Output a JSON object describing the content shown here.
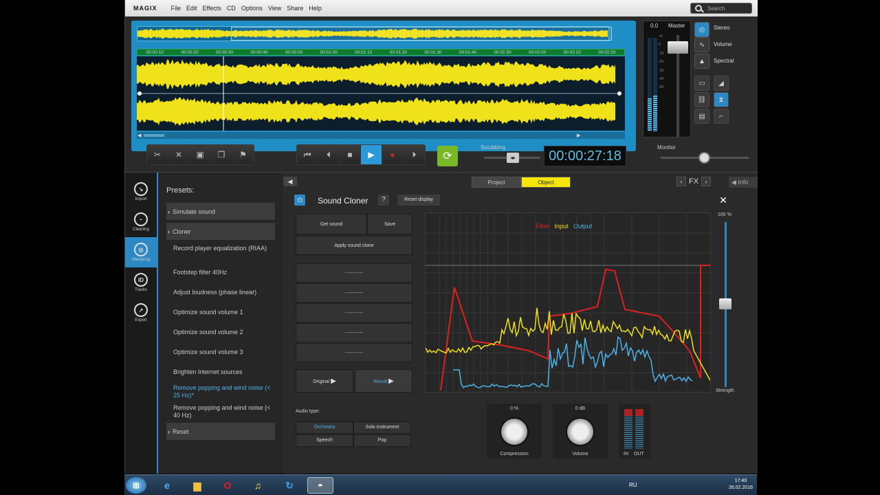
{
  "menubar": {
    "logo": "MAGIX",
    "items": [
      "File",
      "Edit",
      "Effects",
      "CD",
      "Options",
      "View",
      "Share",
      "Help"
    ],
    "search_placeholder": "Search"
  },
  "timeline": {
    "ruler_ticks": [
      "00:00:10",
      "00:00:20",
      "00:00:30",
      "00:00:40",
      "00:00:50",
      "00:01:00",
      "00:01:10",
      "00:01:20",
      "00:01:30",
      "00:01:40",
      "00:01:50",
      "00:02:00",
      "00:02:10",
      "00:02:20"
    ]
  },
  "master": {
    "value": "0.0",
    "label": "Master",
    "db_scale": [
      "+6",
      "0",
      "-10",
      "-20",
      "-30",
      "-40",
      "-50"
    ]
  },
  "view_modes": [
    "Stereo",
    "Volume",
    "Spectral"
  ],
  "transport": {
    "scrubbing_label": "Scrubbing",
    "timecode": "00:00:27:18",
    "monitor_label": "Monitor"
  },
  "sidebar": [
    "Import",
    "Cleaning",
    "Mastering",
    "Tracks",
    "Export"
  ],
  "presets": {
    "title": "Presets:",
    "items": [
      {
        "label": "Simulate sound",
        "type": "header"
      },
      {
        "label": "Cloner",
        "type": "header"
      },
      {
        "label": "Record player equalization (RIAA)",
        "type": "item"
      },
      {
        "label": "Footstep filter 40Hz",
        "type": "item"
      },
      {
        "label": "Adjust loudness (phase linear)",
        "type": "item"
      },
      {
        "label": "Optimize sound volume 1",
        "type": "item"
      },
      {
        "label": "Optimize sound volume 2",
        "type": "item"
      },
      {
        "label": "Optimize sound volume 3",
        "type": "item"
      },
      {
        "label": "Brighten Internet sources",
        "type": "item"
      },
      {
        "label": "Remove popping and wind noise (< 25 Hz)*",
        "type": "selected"
      },
      {
        "label": "Remove popping and wind noise (< 40 Hz)",
        "type": "item"
      },
      {
        "label": "Reset",
        "type": "header"
      }
    ]
  },
  "plugin": {
    "tabs": [
      "Project",
      "Object"
    ],
    "fx_label": "FX",
    "info_label": "Info",
    "title": "Sound Cloner",
    "help": "?",
    "reset_display": "Reset display",
    "get_sound": "Get sound",
    "save": "Save",
    "apply": "Apply sound clone",
    "slots": [
      "----------",
      "----------",
      "----------",
      "----------",
      "----------"
    ],
    "original": "Original",
    "result": "Result",
    "audio_type_label": "Audio type:",
    "audio_types": [
      "Orchestra",
      "Solo instrument",
      "Speech",
      "Pop"
    ],
    "legend": {
      "filter": "Filter",
      "input": "Input",
      "output": "Output"
    },
    "legend_colors": {
      "filter": "#e02020",
      "input": "#f0e21a",
      "output": "#4fb3e8"
    },
    "strength_top": "100 %",
    "strength_label": "Strength",
    "compression": {
      "value": "0 %",
      "label": "Compression"
    },
    "volume": {
      "value": "0 dB",
      "label": "Volume"
    },
    "io_labels": {
      "in": "IN",
      "out": "OUT"
    }
  },
  "taskbar": {
    "lang": "RU",
    "time": "17:40",
    "date": "26.02.2016"
  }
}
